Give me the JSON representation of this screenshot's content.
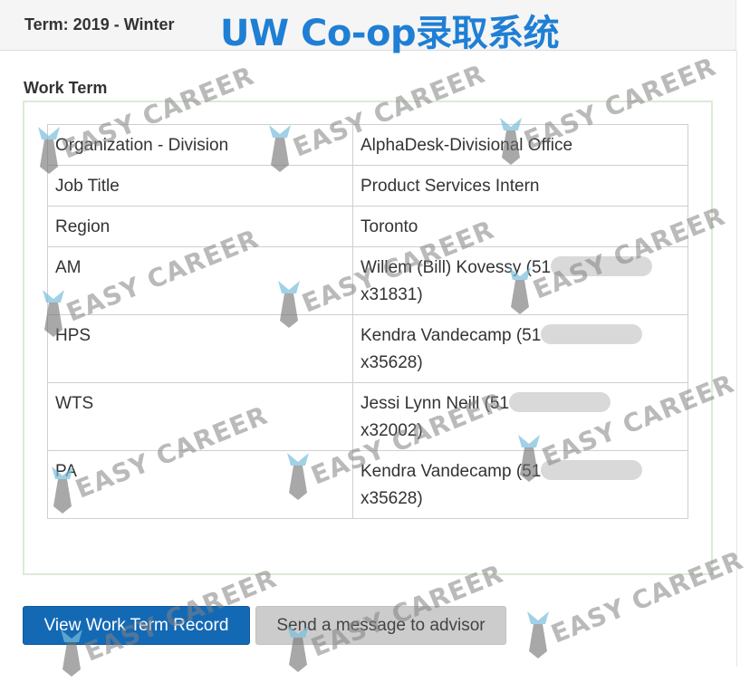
{
  "header": {
    "term": "Term: 2019 - Winter",
    "overlay_title": "UW Co-op录取系统"
  },
  "section": {
    "title": "Work Term"
  },
  "rows": [
    {
      "label": "Organization - Division",
      "value": "AlphaDesk-Divisional Office",
      "second_line": ""
    },
    {
      "label": "Job Title",
      "value": "Product Services Intern",
      "second_line": ""
    },
    {
      "label": "Region",
      "value": "Toronto",
      "second_line": ""
    },
    {
      "label": "AM",
      "value": "Willem (Bill) Kovessy (51",
      "second_line": "x31831)"
    },
    {
      "label": "HPS",
      "value": "Kendra Vandecamp (51",
      "second_line": "x35628)"
    },
    {
      "label": "WTS",
      "value": "Jessi Lynn Neill (51",
      "second_line": "x32002)"
    },
    {
      "label": "PA",
      "value": "Kendra Vandecamp (51",
      "second_line": "x35628)"
    }
  ],
  "buttons": {
    "view_record": "View Work Term Record",
    "message_advisor": "Send a message to advisor"
  },
  "watermark": {
    "text": "EASY CAREER",
    "icon": "tie-icon"
  },
  "colors": {
    "primary_button": "#1469b5",
    "title_overlay": "#1f7fd4",
    "panel_border": "#dcebd6"
  }
}
